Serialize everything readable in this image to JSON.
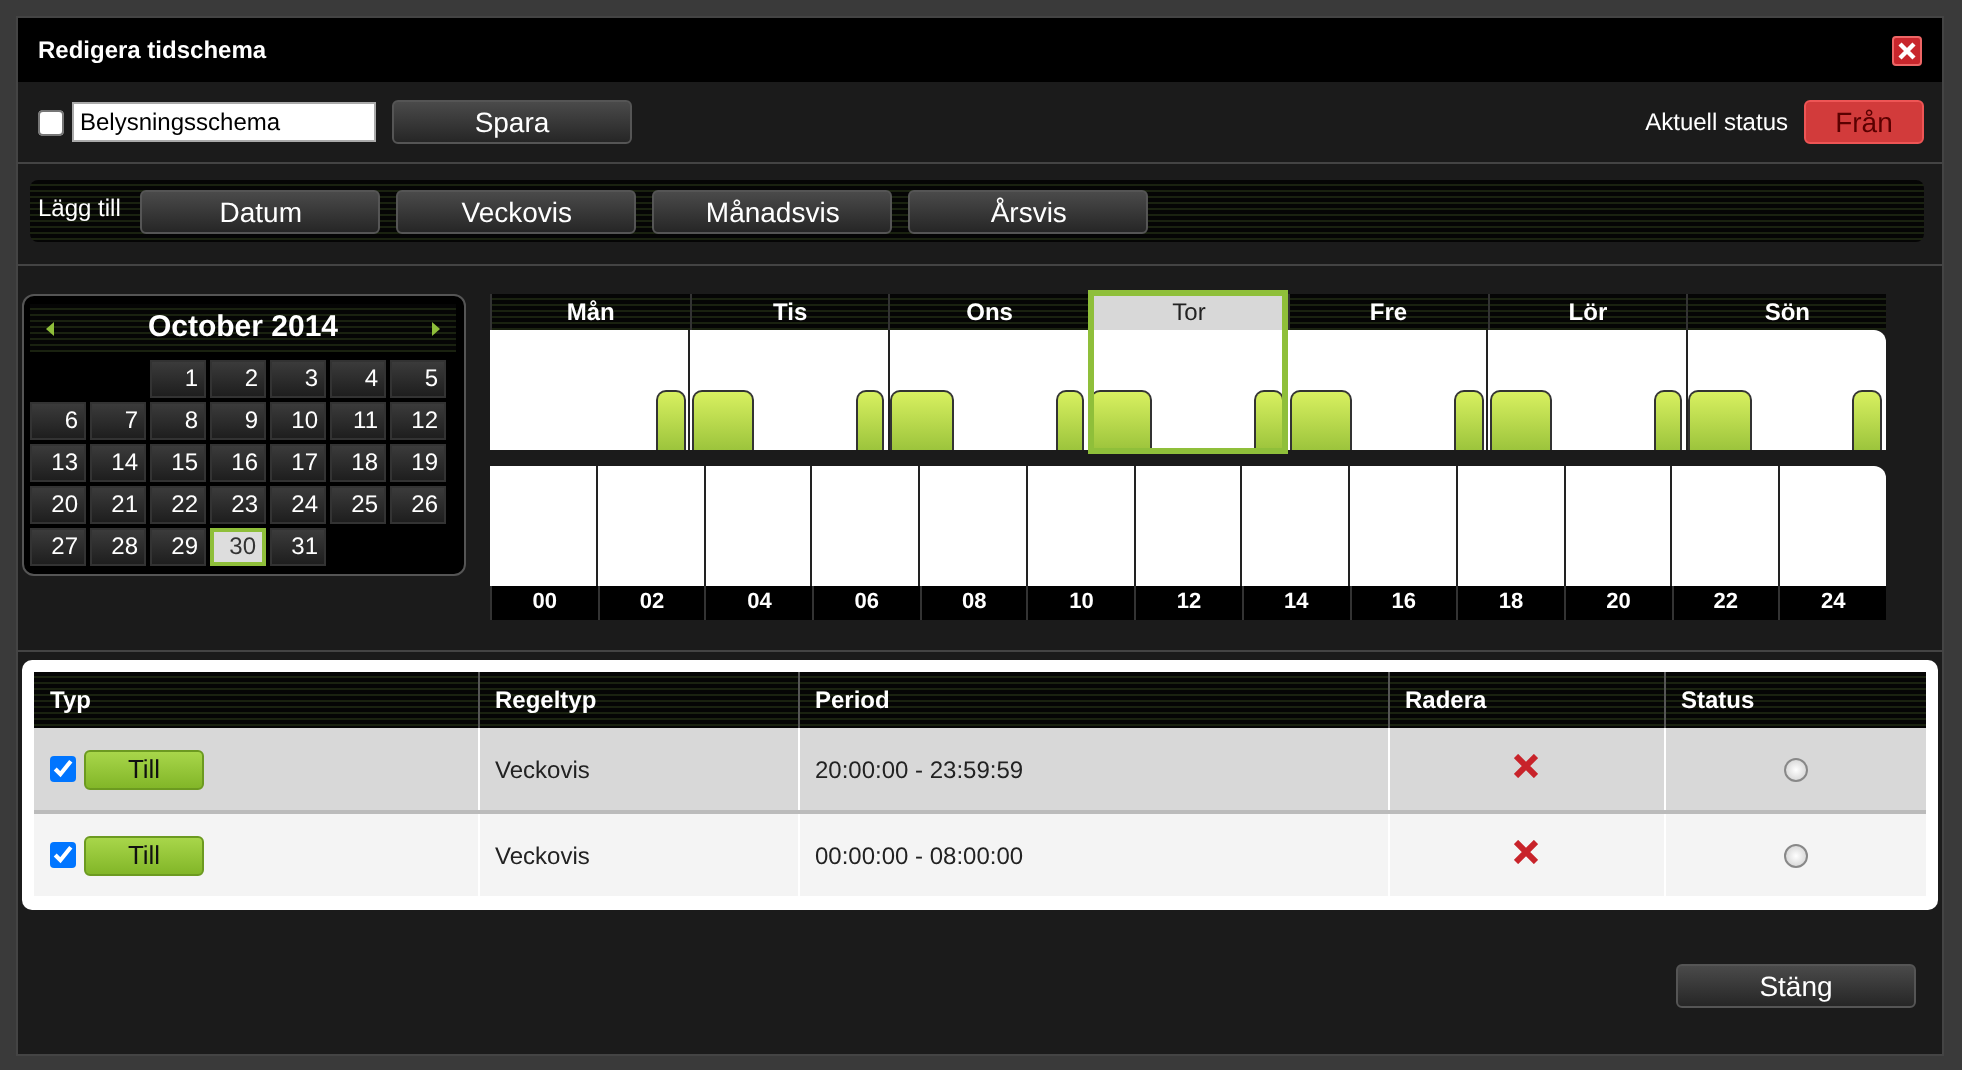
{
  "window": {
    "title": "Redigera tidschema"
  },
  "toolbar": {
    "name_checkbox_checked": false,
    "name_value": "Belysningsschema",
    "save_button": "Spara",
    "status_label": "Aktuell status",
    "status_button": "Från"
  },
  "add_bar": {
    "label": "Lägg till",
    "buttons": [
      "Datum",
      "Veckovis",
      "Månadsvis",
      "Årsvis"
    ]
  },
  "calendar": {
    "title": "October 2014",
    "days": [
      {
        "label": "1",
        "selected": false
      },
      {
        "label": "2",
        "selected": false
      },
      {
        "label": "3",
        "selected": false
      },
      {
        "label": "4",
        "selected": false
      },
      {
        "label": "5",
        "selected": false
      },
      {
        "label": "6",
        "selected": false
      },
      {
        "label": "7",
        "selected": false
      },
      {
        "label": "8",
        "selected": false
      },
      {
        "label": "9",
        "selected": false
      },
      {
        "label": "10",
        "selected": false
      },
      {
        "label": "11",
        "selected": false
      },
      {
        "label": "12",
        "selected": false
      },
      {
        "label": "13",
        "selected": false
      },
      {
        "label": "14",
        "selected": false
      },
      {
        "label": "15",
        "selected": false
      },
      {
        "label": "16",
        "selected": false
      },
      {
        "label": "17",
        "selected": false
      },
      {
        "label": "18",
        "selected": false
      },
      {
        "label": "19",
        "selected": false
      },
      {
        "label": "20",
        "selected": false
      },
      {
        "label": "21",
        "selected": false
      },
      {
        "label": "22",
        "selected": false
      },
      {
        "label": "23",
        "selected": false
      },
      {
        "label": "24",
        "selected": false
      },
      {
        "label": "25",
        "selected": false
      },
      {
        "label": "26",
        "selected": false
      },
      {
        "label": "27",
        "selected": false
      },
      {
        "label": "28",
        "selected": false
      },
      {
        "label": "29",
        "selected": false
      },
      {
        "label": "30",
        "selected": true
      },
      {
        "label": "31",
        "selected": false
      }
    ]
  },
  "week": {
    "days": [
      {
        "label": "Mån",
        "selected": false
      },
      {
        "label": "Tis",
        "selected": false
      },
      {
        "label": "Ons",
        "selected": false
      },
      {
        "label": "Tor",
        "selected": true
      },
      {
        "label": "Fre",
        "selected": false
      },
      {
        "label": "Lör",
        "selected": false
      },
      {
        "label": "Sön",
        "selected": false
      }
    ],
    "hours": [
      "00",
      "02",
      "04",
      "06",
      "08",
      "10",
      "12",
      "14",
      "16",
      "18",
      "20",
      "22",
      "24"
    ]
  },
  "table": {
    "columns": [
      "Typ",
      "Regeltyp",
      "Period",
      "Radera",
      "Status"
    ],
    "rows": [
      {
        "checked": true,
        "type": "Till",
        "rule_type": "Veckovis",
        "period": "20:00:00 - 23:59:59",
        "active": false
      },
      {
        "checked": true,
        "type": "Till",
        "rule_type": "Veckovis",
        "period": "00:00:00 - 08:00:00",
        "active": false
      }
    ]
  },
  "footer": {
    "close_button": "Stäng"
  }
}
